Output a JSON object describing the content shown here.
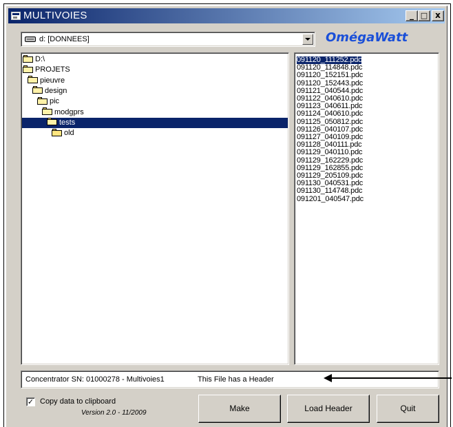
{
  "window": {
    "title": "MULTIVOIES",
    "minimize_glyph": "_",
    "maximize_glyph": "□",
    "close_glyph": "x"
  },
  "drive_combo": {
    "value": "d: [DONNEES]"
  },
  "brand": "OmégaWatt",
  "directory_tree": [
    {
      "label": "D:\\",
      "level": 0,
      "selected": false
    },
    {
      "label": "PROJETS",
      "level": 0,
      "selected": false
    },
    {
      "label": "pieuvre",
      "level": 1,
      "selected": false
    },
    {
      "label": "design",
      "level": 2,
      "selected": false
    },
    {
      "label": "pic",
      "level": 3,
      "selected": false
    },
    {
      "label": "modgprs",
      "level": 4,
      "selected": false
    },
    {
      "label": "tests",
      "level": 5,
      "selected": true
    },
    {
      "label": "old",
      "level": 6,
      "selected": false
    }
  ],
  "files": [
    "091120_111252.pdc",
    "091120_114848.pdc",
    "091120_152151.pdc",
    "091120_152443.pdc",
    "091121_040544.pdc",
    "091122_040610.pdc",
    "091123_040611.pdc",
    "091124_040610.pdc",
    "091125_050812.pdc",
    "091126_040107.pdc",
    "091127_040109.pdc",
    "091128_040111.pdc",
    "091129_040110.pdc",
    "091129_162229.pdc",
    "091129_162855.pdc",
    "091129_205109.pdc",
    "091130_040531.pdc",
    "091130_114748.pdc",
    "091201_040547.pdc"
  ],
  "selected_file_index": 0,
  "status": {
    "serial": "Concentrator SN: 01000278 - Multivoies1",
    "header": "This File has a Header"
  },
  "checkbox": {
    "label": "Copy data to clipboard",
    "checked": true,
    "mark": "✓"
  },
  "version": "Version 2.0 - 11/2009",
  "buttons": {
    "make": "Make",
    "load_header": "Load Header",
    "quit": "Quit"
  }
}
